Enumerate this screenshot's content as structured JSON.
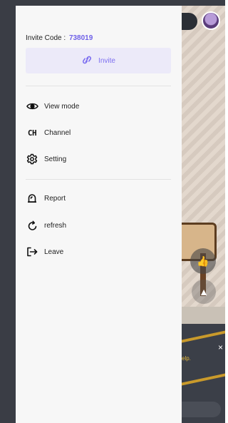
{
  "drawer": {
    "invite_code_label": "Invite Code :",
    "invite_code_value": "738019",
    "invite_button_label": "Invite",
    "menu_primary": [
      {
        "key": "view-mode",
        "label": "View mode",
        "icon": "eye-icon"
      },
      {
        "key": "channel",
        "label": "Channel",
        "icon": "channel-ch-icon",
        "icon_text": "CH"
      },
      {
        "key": "setting",
        "label": "Setting",
        "icon": "gear-icon"
      }
    ],
    "menu_secondary": [
      {
        "key": "report",
        "label": "Report",
        "icon": "alarm-bell-icon"
      },
      {
        "key": "refresh",
        "label": "refresh",
        "icon": "refresh-icon"
      },
      {
        "key": "leave",
        "label": "Leave",
        "icon": "logout-arrow-icon"
      }
    ]
  },
  "game": {
    "hint_text": "elp.",
    "close_glyph": "×",
    "thumb_glyph": "👍",
    "up_glyph": "▲"
  },
  "colors": {
    "accent": "#6f61e8",
    "invite_button_bg": "#eceaf9",
    "drawer_bg": "#f7f7f7",
    "backdrop": "#3a3d45"
  }
}
